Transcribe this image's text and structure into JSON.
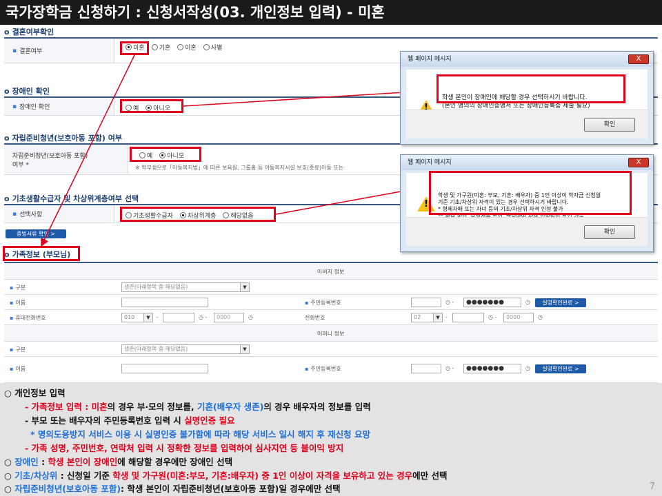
{
  "slide_title": "국가장학금 신청하기 : 신청서작성(03. 개인정보 입력) - 미혼",
  "sections": {
    "marital": {
      "heading": "결혼여부확인",
      "label": "결혼여부",
      "options": [
        "미혼",
        "기혼",
        "이혼",
        "사별"
      ],
      "selected": "미혼"
    },
    "disability": {
      "heading": "장애인 확인",
      "label": "장애인 확인",
      "options": [
        "예",
        "아니오"
      ],
      "selected": "아니오"
    },
    "independent": {
      "heading": "자립준비청년(보호아동 포함) 여부",
      "label_line1": "자립준비청년(보호아동 포함)",
      "label_line2": "여부 *",
      "options": [
        "예",
        "아니오"
      ],
      "selected": "아니오",
      "note": "※ 학부생으로「아동복지법」에 따른 보육원, 그룹홈 등 아동복지시설 보호(종료)아동 또는 "
    },
    "basic_living": {
      "heading": "기초생활수급자 및 차상위계층여부 선택",
      "label": "선택사항",
      "options": [
        "기초생활수급자",
        "차상위계층",
        "해당없음"
      ],
      "selected": "차상위계층",
      "button": "증빙서류 확인 >"
    },
    "family": {
      "heading": "가족정보 (부모님)",
      "father_header": "아버지 정보",
      "mother_header": "어머니 정보",
      "label_type": "구분",
      "label_name": "이름",
      "label_rrn": "주민등록번호",
      "label_mobile": "휴대전화번호",
      "label_phone": "전화번호",
      "select_placeholder": "생존(아래항목 중 해당없음)",
      "rrn_mask": "●●●●●●●",
      "verify_button": "실명확인완료 >",
      "mobile_prefix": "010",
      "phone_prefix": "02",
      "number_placeholder": "0000"
    }
  },
  "dialog1": {
    "title": "웹 페이지 메시지",
    "close": "X",
    "line1": "학생 본인이 장애인에 해당할 경우 선택하시기 바랍니다.",
    "line2": "(본인 명의의 장애인증명서 또는 장애인등록증 제출 필요)",
    "ok": "확인"
  },
  "dialog2": {
    "title": "웹 페이지 메시지",
    "close": "X",
    "line1": "학생 및 가구원(미혼: 부모, 기혼: 배우자) 중 1인 이상이 학자금 신청일",
    "line2": "기준 기초/차상위 자격이 있는 경우 선택하시기 바랍니다.",
    "line3": "* 형제자매 또는 자녀 등의 기초/차상위 자격 인정 불가",
    "line4": "** 좌측 하단 '증빙서류 확인' 클릭하여 자격 인정범위 확인 가능",
    "ok": "확인"
  },
  "notes": {
    "n1": "○ 개인정보 입력",
    "n2a": "- 가족정보 입력 : ",
    "n2b": "미혼",
    "n2c": "의 경우 부·모의 정보를, ",
    "n2d": "기혼(배우자 생존)",
    "n2e": "의 경우 배우자의 정보를 입력",
    "n3a": "- 부모 또는 배우자의 주민등록번호 입력 시 ",
    "n3b": "실명인증 필요",
    "n4": "* 명의도용방지 서비스 이용 시 실명인증 불가함에 따라 해당 서비스 일시 해지 후 재신청 요망",
    "n5": "- 가족 성명, 주민번호, 연락처 입력 시 정확한 정보를 입력하여 심사지연 등 불이익 방지",
    "n6a": "○ ",
    "n6b": "장애인",
    "n6c": " : ",
    "n6d": "학생 본인이 장애인",
    "n6e": "에 해당할 경우에만 장애인 선택",
    "n7a": "○ ",
    "n7b": "기초/차상위",
    "n7c": " : 신청일 기준 ",
    "n7d": "학생 및 가구원(미혼:부모, 기혼:배우자) 중 1인 이상이 자격을 보유하고 있는 경우",
    "n7e": "에만 선택",
    "n8a": "○ ",
    "n8b": "자립준비청년(보호아동 포함)",
    "n8c": ": 학생 본인이 자립준비청년(보호아동 포함)일 경우에만 선택",
    "page": "7"
  },
  "colors": {
    "highlight_red": "#e0001b",
    "note_blue": "#1e6fd9",
    "header_navy": "#1a3f73"
  }
}
